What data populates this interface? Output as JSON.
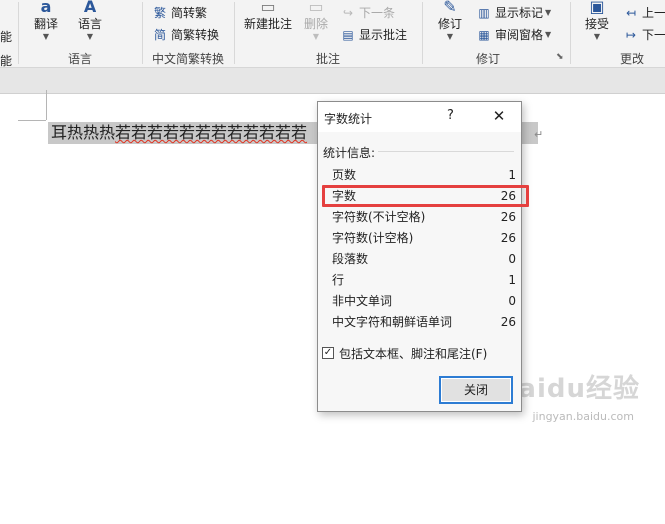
{
  "ribbon": {
    "partial_left": "能",
    "partial_left2": "能",
    "lang_group": {
      "label": "语言",
      "translate": "翻译",
      "language": "语言"
    },
    "chinese_group": {
      "label": "中文简繁转换",
      "to_traditional": "简转繁",
      "to_traditional_icon": "繁",
      "convert": "简繁转换",
      "convert_icon": "简"
    },
    "comments_group": {
      "label": "批注",
      "new_comment": "新建批注",
      "delete": "删除",
      "next": "下一条",
      "show_comments": "显示批注"
    },
    "tracking_group": {
      "label": "修订",
      "track_changes": "修订",
      "show_markup": "显示标记",
      "reviewing_pane": "审阅窗格"
    },
    "changes_group": {
      "label": "更改",
      "accept": "接受",
      "previous": "上一",
      "next": "下一"
    }
  },
  "document": {
    "text_plain": "耳热热热",
    "text_squiggle": "若若若若若若若若若若若若",
    "para_mark": "↵"
  },
  "watermark": {
    "brand": "Baidu经验",
    "url": "jingyan.baidu.com"
  },
  "dialog": {
    "title": "字数统计",
    "help": "?",
    "close_glyph": "✕",
    "section_title": "统计信息:",
    "stats": [
      {
        "label": "页数",
        "value": "1"
      },
      {
        "label": "字数",
        "value": "26"
      },
      {
        "label": "字符数(不计空格)",
        "value": "26"
      },
      {
        "label": "字符数(计空格)",
        "value": "26"
      },
      {
        "label": "段落数",
        "value": "0"
      },
      {
        "label": "行",
        "value": "1"
      },
      {
        "label": "非中文单词",
        "value": "0"
      },
      {
        "label": "中文字符和朝鲜语单词",
        "value": "26"
      }
    ],
    "checkbox_label": "包括文本框、脚注和尾注(F)",
    "checkbox_mark": "✓",
    "close_button": "关闭"
  },
  "colors": {
    "highlight": "#e5403f",
    "accent": "#2b579a",
    "button_focus": "#2d7cd3"
  }
}
